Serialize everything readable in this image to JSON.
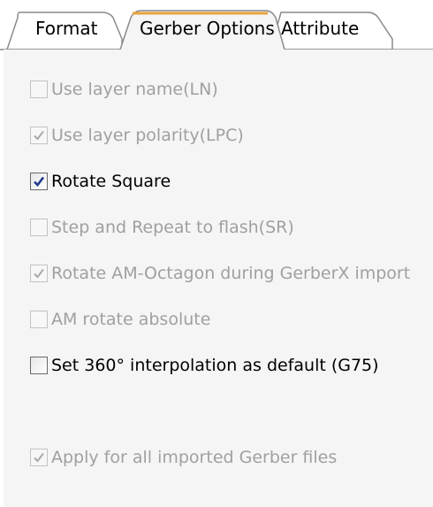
{
  "tabs": [
    {
      "label": "Format",
      "active": false
    },
    {
      "label": "Gerber Options",
      "active": true
    },
    {
      "label": "Attribute",
      "active": false
    }
  ],
  "options": [
    {
      "label": "Use layer name(LN)",
      "checked": false,
      "enabled": false
    },
    {
      "label": "Use layer polarity(LPC)",
      "checked": true,
      "enabled": false
    },
    {
      "label": "Rotate Square",
      "checked": true,
      "enabled": true
    },
    {
      "label": "Step and Repeat to flash(SR)",
      "checked": false,
      "enabled": false
    },
    {
      "label": "Rotate AM-Octagon during GerberX import",
      "checked": true,
      "enabled": false
    },
    {
      "label": "AM rotate absolute",
      "checked": false,
      "enabled": false
    },
    {
      "label": "Set 360° interpolation as default (G75)",
      "checked": false,
      "enabled": true
    },
    {
      "label": "Apply for all imported Gerber files",
      "checked": true,
      "enabled": false
    }
  ],
  "colors": {
    "panel_bg": "#f5f5f5",
    "tab_active_bg": "#f5f5f5",
    "tab_border": "#8a8a8a",
    "tab_accent": "#e8a23a",
    "disabled_text": "#a0a0a0",
    "enabled_text": "#000000",
    "check_enabled": "#1f3a8f",
    "check_disabled": "#a8a8a8"
  },
  "icons": {
    "check": "check-mark-icon"
  }
}
